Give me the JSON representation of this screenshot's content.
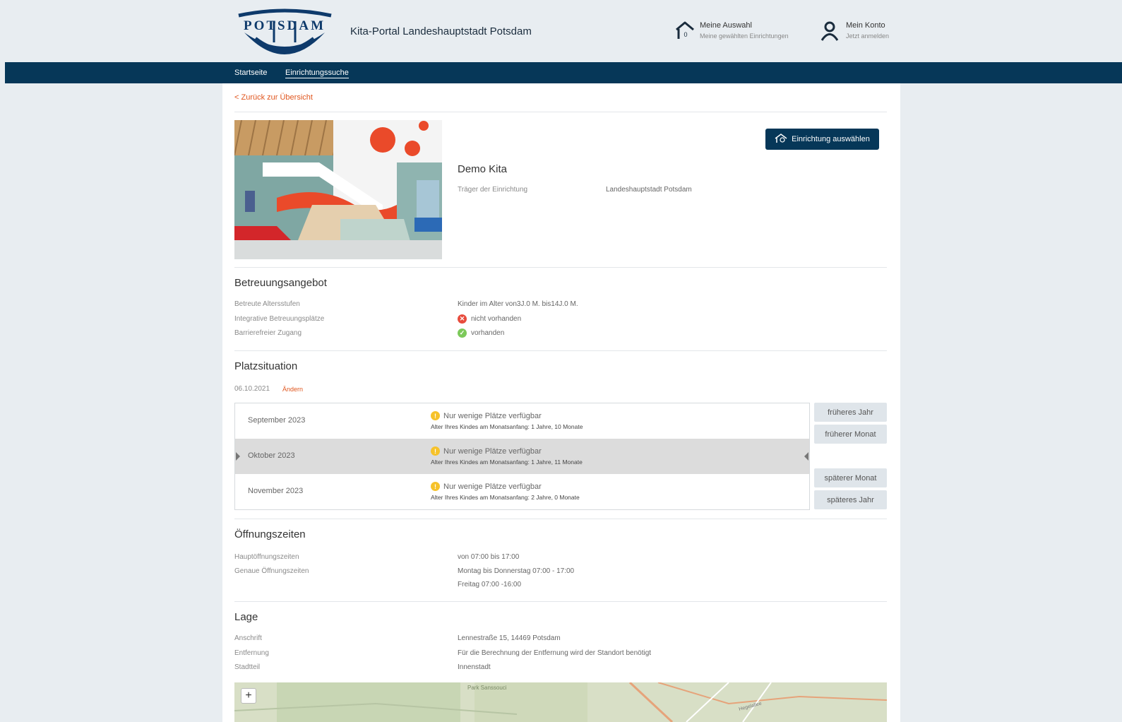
{
  "header": {
    "portal_title": "Kita-Portal Landeshauptstadt Potsdam",
    "logo_text": "POTSDAM",
    "auswahl": {
      "title": "Meine Auswahl",
      "subtitle": "Meine gewählten Einrichtungen",
      "count": "0"
    },
    "konto": {
      "title": "Mein Konto",
      "subtitle": "Jetzt anmelden"
    }
  },
  "nav": {
    "items": [
      "Startseite",
      "Einrichtungssuche"
    ],
    "active": "Einrichtungssuche"
  },
  "back_link": "< Zurück zur Übersicht",
  "facility": {
    "name": "Demo Kita",
    "traeger_label": "Träger der Einrichtung",
    "traeger_value": "Landeshauptstadt Potsdam",
    "select_button": "Einrichtung auswählen"
  },
  "betreuung": {
    "title": "Betreuungsangebot",
    "rows": [
      {
        "label": "Betreute Altersstufen",
        "value": "Kinder im Alter von3J.0 M. bis14J.0 M.",
        "icon": ""
      },
      {
        "label": "Integrative Betreuungsplätze",
        "value": "nicht vorhanden",
        "icon": "cross-circle-icon"
      },
      {
        "label": "Barrierefreier Zugang",
        "value": "vorhanden",
        "icon": "check-circle-icon"
      }
    ]
  },
  "platz": {
    "title": "Platzsituation",
    "date": "06.10.2021",
    "aendern": "Ändern",
    "months": [
      {
        "name": "September 2023",
        "status": "Nur wenige Plätze verfügbar",
        "age": "Alter Ihres Kindes am Monatsanfang:  1 Jahre, 10 Monate"
      },
      {
        "name": "Oktober 2023",
        "status": "Nur wenige Plätze verfügbar",
        "age": "Alter Ihres Kindes am Monatsanfang:  1 Jahre, 11 Monate"
      },
      {
        "name": "November 2023",
        "status": "Nur wenige Plätze verfügbar",
        "age": "Alter Ihres Kindes am Monatsanfang:  2 Jahre, 0 Monate"
      }
    ],
    "buttons": {
      "frueheres_jahr": "früheres Jahr",
      "frueherer_monat": "früherer Monat",
      "spaeterer_monat": "späterer Monat",
      "spaeteres_jahr": "späteres Jahr"
    }
  },
  "oeffnung": {
    "title": "Öffnungszeiten",
    "haupt_label": "Hauptöffnungszeiten",
    "haupt_value": "von 07:00  bis 17:00",
    "genau_label": "Genaue Öffnungszeiten",
    "genau_value_1": "Montag bis Donnerstag 07:00 - 17:00",
    "genau_value_2": "Freitag 07:00 -16:00"
  },
  "lage": {
    "title": "Lage",
    "anschrift_label": "Anschrift",
    "anschrift_value": "Lennestraße 15, 14469 Potsdam",
    "entfernung_label": "Entfernung",
    "entfernung_value": "Für die Berechnung der Entfernung wird der Standort benötigt",
    "stadtteil_label": "Stadtteil",
    "stadtteil_value": "Innenstadt",
    "map_label_park": "Park Sanssouci",
    "map_label_street": "Hegelallee",
    "zoom_in": "+"
  },
  "colors": {
    "navy": "#063758",
    "accent": "#e0561e",
    "background": "#e8edf1"
  }
}
